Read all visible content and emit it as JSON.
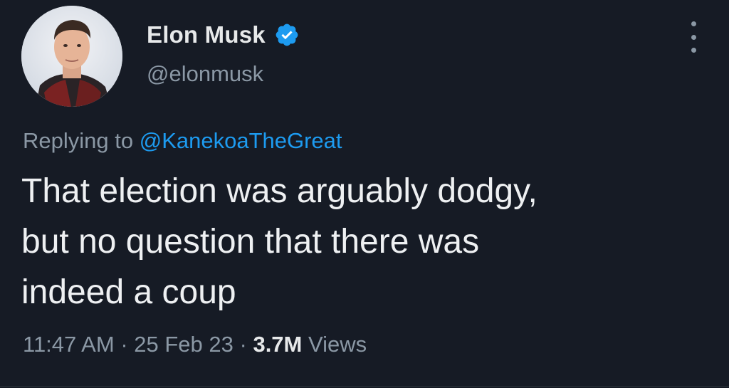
{
  "author": {
    "display_name": "Elon Musk",
    "handle": "@elonmusk",
    "verified_icon": "verified-badge-icon",
    "avatar": "profile-photo"
  },
  "reply": {
    "prefix": "Replying to",
    "to_handle": "@KanekoaTheGreat"
  },
  "tweet": {
    "lines": [
      "That election was arguably dodgy,",
      "but no question that there was",
      "indeed a coup"
    ]
  },
  "meta": {
    "time": "11:47 AM",
    "sep1": "·",
    "date": "25 Feb 23",
    "sep2": "·",
    "views_count": "3.7M",
    "views_label": "Views"
  },
  "colors": {
    "background": "#161b25",
    "accent": "#1d9bf0",
    "secondary_text": "#8b98a5"
  },
  "icons": {
    "more": "more-vertical-icon"
  }
}
